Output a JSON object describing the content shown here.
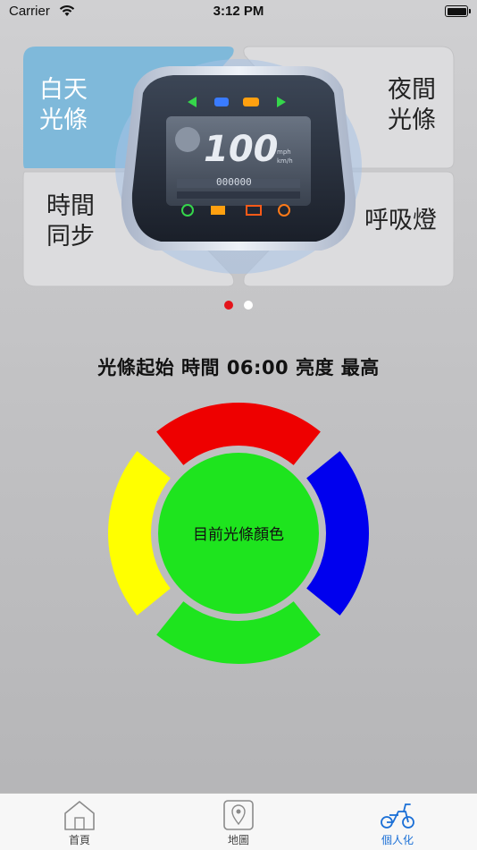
{
  "status_bar": {
    "carrier": "Carrier",
    "time": "3:12 PM"
  },
  "dashboard": {
    "quadrants": [
      {
        "id": "day",
        "lines": [
          "白天",
          "光條"
        ],
        "active": true
      },
      {
        "id": "night",
        "lines": [
          "夜間",
          "光條"
        ],
        "active": false
      },
      {
        "id": "time-sync",
        "lines": [
          "時間",
          "同步"
        ],
        "active": false
      },
      {
        "id": "breathing",
        "lines": [
          "呼吸燈"
        ],
        "active": false
      }
    ],
    "meter": {
      "speed": "100",
      "unit_top": "mph",
      "unit_bottom": "km/h",
      "odometer": "000000"
    },
    "page_count": 2,
    "current_page": 1
  },
  "info_line": "光條起始 時間 06:00  亮度 最高",
  "color_wheel": {
    "center_label": "目前光條顏色",
    "center_color": "#1ee41e",
    "segments": {
      "top": "#ee0000",
      "right": "#0000ee",
      "bottom": "#1ee41e",
      "left": "#ffff00"
    }
  },
  "tab_bar": {
    "tabs": [
      {
        "label": "首頁",
        "icon": "home-icon",
        "active": false
      },
      {
        "label": "地圖",
        "icon": "map-icon",
        "active": false
      },
      {
        "label": "個人化",
        "icon": "scooter-icon",
        "active": true
      }
    ],
    "active_color": "#1a6fd6"
  }
}
